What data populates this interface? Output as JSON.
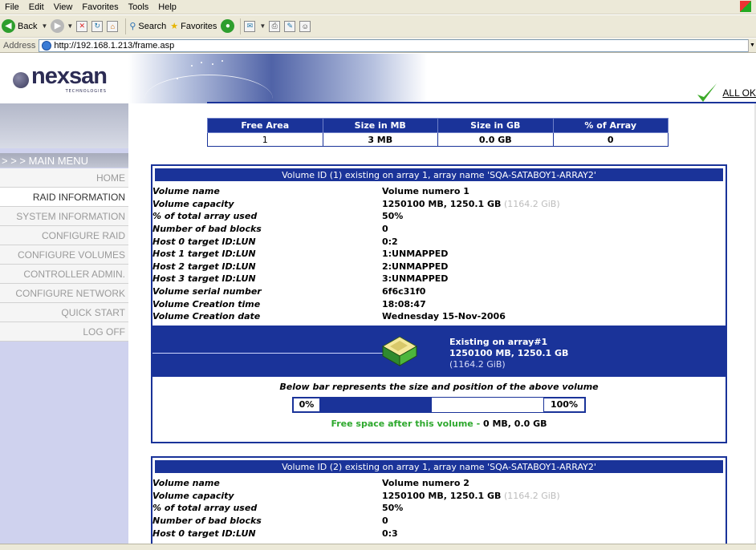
{
  "browser": {
    "menu": [
      "File",
      "Edit",
      "View",
      "Favorites",
      "Tools",
      "Help"
    ],
    "toolbar": {
      "back": "Back",
      "search": "Search",
      "favorites": "Favorites"
    },
    "address_label": "Address",
    "url": "http://192.168.1.213/frame.asp"
  },
  "banner": {
    "logo": "nexsan",
    "logo_sub": "TECHNOLOGIES",
    "status": "ALL OK"
  },
  "sidebar": {
    "title": "> > > MAIN MENU",
    "items": [
      {
        "label": "HOME"
      },
      {
        "label": "RAID INFORMATION"
      },
      {
        "label": "SYSTEM INFORMATION"
      },
      {
        "label": "CONFIGURE RAID"
      },
      {
        "label": "CONFIGURE VOLUMES"
      },
      {
        "label": "CONTROLLER ADMIN."
      },
      {
        "label": "CONFIGURE NETWORK"
      },
      {
        "label": "QUICK START"
      },
      {
        "label": "LOG OFF"
      }
    ]
  },
  "free_area": {
    "headers": [
      "Free Area",
      "Size in MB",
      "Size in GB",
      "% of Array"
    ],
    "row": [
      "1",
      "3 MB",
      "0.0 GB",
      "0"
    ]
  },
  "volumes": [
    {
      "header": "Volume ID (1) existing on array 1, array name 'SQA-SATABOY1-ARRAY2'",
      "rows": [
        {
          "label": "Volume name",
          "value": "Volume numero 1"
        },
        {
          "label": "Volume capacity",
          "value": "1250100 MB, 1250.1 GB",
          "extra": "(1164.2 GiB)"
        },
        {
          "label": "% of total array used",
          "value": "50%"
        },
        {
          "label": "Number of bad blocks",
          "value": "0"
        },
        {
          "label": "Host 0 target ID:LUN",
          "value": "0:2"
        },
        {
          "label": "Host 1 target ID:LUN",
          "value": "1:UNMAPPED"
        },
        {
          "label": "Host 2 target ID:LUN",
          "value": "2:UNMAPPED"
        },
        {
          "label": "Host 3 target ID:LUN",
          "value": "3:UNMAPPED"
        },
        {
          "label": "Volume serial number",
          "value": "6f6c31f0"
        },
        {
          "label": "Volume Creation time",
          "value": "18:08:47"
        },
        {
          "label": "Volume Creation date",
          "value": "Wednesday 15-Nov-2006"
        }
      ],
      "array": {
        "line1": "Existing on array#1",
        "line2": "1250100 MB, 1250.1 GB",
        "line3": "(1164.2 GiB)"
      },
      "bar_caption": "Below bar represents the size and position of the above volume",
      "bar": {
        "left_label": "0%",
        "right_label": "100%",
        "fill_fraction": 0.5
      },
      "free_space": {
        "label": "Free space after this volume - ",
        "value": "0 MB, 0.0 GB"
      }
    },
    {
      "header": "Volume ID (2) existing on array 1, array name 'SQA-SATABOY1-ARRAY2'",
      "rows": [
        {
          "label": "Volume name",
          "value": "Volume numero 2"
        },
        {
          "label": "Volume capacity",
          "value": "1250100 MB, 1250.1 GB",
          "extra": "(1164.2 GiB)"
        },
        {
          "label": "% of total array used",
          "value": "50%"
        },
        {
          "label": "Number of bad blocks",
          "value": "0"
        },
        {
          "label": "Host 0 target ID:LUN",
          "value": "0:3"
        }
      ]
    }
  ],
  "colors": {
    "accent": "#1a3399",
    "sidebar": "#cfd2ee",
    "ok_green": "#2da82d"
  }
}
